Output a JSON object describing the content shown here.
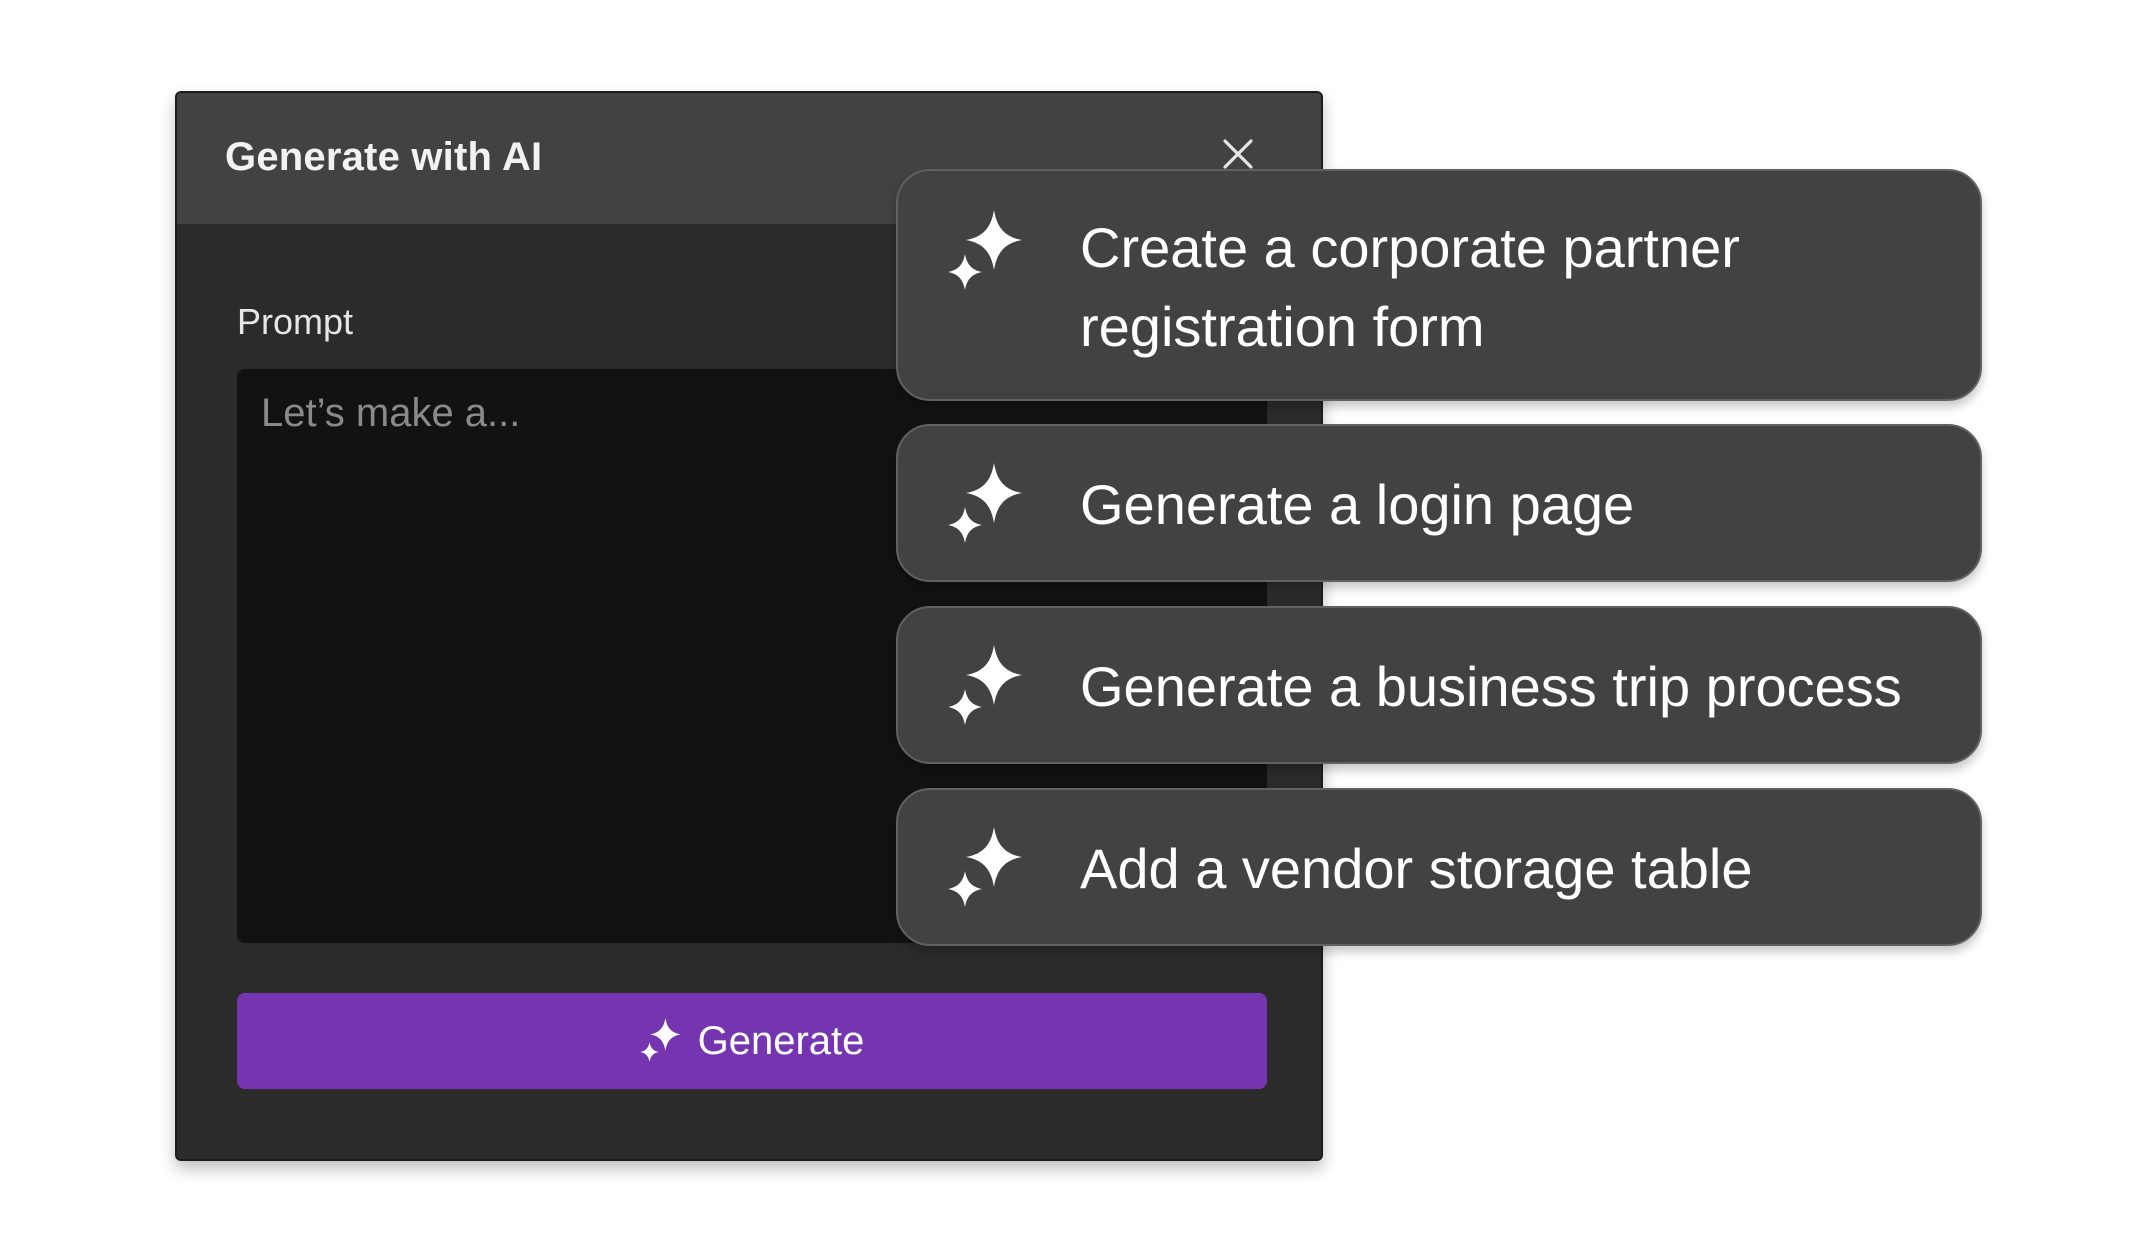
{
  "dialog": {
    "title": "Generate with AI",
    "close_icon": "close-icon",
    "prompt_label": "Prompt",
    "prompt_placeholder": "Let’s make a...",
    "prompt_value": "",
    "generate_label": "Generate",
    "generate_icon": "sparkle-icon",
    "accent_color": "#7535b1"
  },
  "suggestions": [
    {
      "label": "Create a corporate partner registration form",
      "icon": "sparkle-icon"
    },
    {
      "label": "Generate a login page",
      "icon": "sparkle-icon"
    },
    {
      "label": "Generate a business trip process",
      "icon": "sparkle-icon"
    },
    {
      "label": "Add a vendor storage table",
      "icon": "sparkle-icon"
    }
  ]
}
